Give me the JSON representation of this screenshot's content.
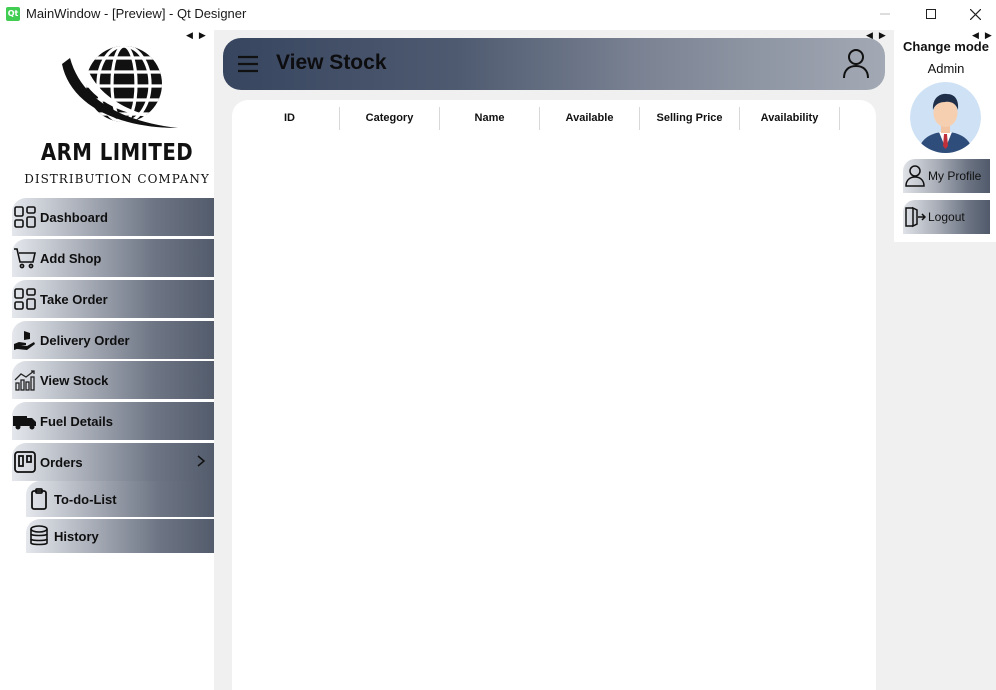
{
  "window": {
    "icon_text": "Qt",
    "title": "MainWindow - [Preview] - Qt Designer",
    "minimize_icon": "minimize-icon",
    "maximize_icon": "maximize-icon",
    "close_icon": "close-icon"
  },
  "logo": {
    "title": "ARM LIMITED",
    "subtitle": "DISTRIBUTION COMPANY"
  },
  "nav": {
    "items": [
      {
        "label": "Dashboard",
        "icon": "dashboard-grid-icon"
      },
      {
        "label": "Add Shop",
        "icon": "cart-icon"
      },
      {
        "label": "Take Order",
        "icon": "grid-icon"
      },
      {
        "label": "Delivery Order",
        "icon": "delivery-hand-icon"
      },
      {
        "label": "View Stock",
        "icon": "stock-chart-icon"
      },
      {
        "label": "Fuel Details",
        "icon": "truck-icon"
      },
      {
        "label": "Orders",
        "icon": "orders-board-icon"
      }
    ],
    "sub_items": [
      {
        "label": "To-do-List",
        "icon": "clipboard-icon"
      },
      {
        "label": "History",
        "icon": "database-icon"
      }
    ]
  },
  "header": {
    "title": "View Stock"
  },
  "table": {
    "columns": [
      "ID",
      "Category",
      "Name",
      "Available",
      "Selling Price",
      "Availability"
    ],
    "rows": []
  },
  "profile": {
    "change_mode_label": "Change mode",
    "role": "Admin",
    "my_profile_label": "My Profile",
    "logout_label": "Logout"
  },
  "colors": {
    "header_gradient_start": "#37455f",
    "header_gradient_end": "#a3a9b4",
    "nav_gradient_start": "#e4e7ec",
    "nav_gradient_end": "#535c6c",
    "panel_background": "#f0f0f0"
  }
}
